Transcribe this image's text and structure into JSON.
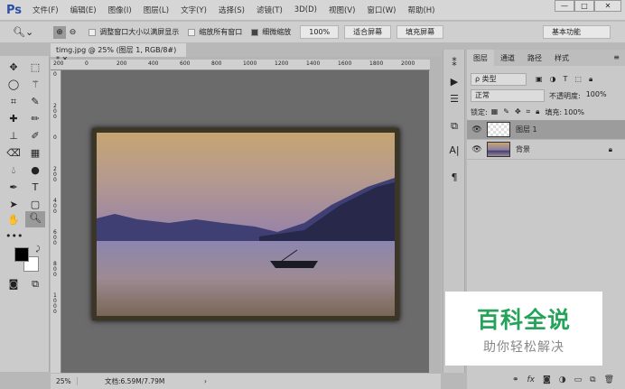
{
  "app": {
    "logo": "Ps"
  },
  "menu": [
    "文件(F)",
    "编辑(E)",
    "图像(I)",
    "图层(L)",
    "文字(Y)",
    "选择(S)",
    "滤镜(T)",
    "3D(D)",
    "视图(V)",
    "窗口(W)",
    "帮助(H)"
  ],
  "window_controls": {
    "minimize": "—",
    "maximize": "□",
    "close": "✕"
  },
  "options": {
    "resize_windows": "调整窗口大小以满屏显示",
    "resize_checked": false,
    "zoom_all": "缩放所有窗口",
    "zoom_all_checked": false,
    "scrubby": "细微缩放",
    "scrubby_checked": true,
    "btn_100": "100%",
    "btn_fit": "适合屏幕",
    "btn_fill": "填充屏幕",
    "workspace": "基本功能"
  },
  "document": {
    "tab": "timg.jpg @ 25% (图层 1, RGB/8#) *",
    "close": "✕"
  },
  "ruler": {
    "top": [
      "200",
      "0",
      "200",
      "400",
      "600",
      "800",
      "1000",
      "1200",
      "1400",
      "1600",
      "1800",
      "2000"
    ],
    "left": [
      "0",
      "200",
      "0",
      "200",
      "400",
      "600",
      "800",
      "1000"
    ]
  },
  "status": {
    "zoom": "25%",
    "doc": "文档:6.59M/7.79M",
    "arrow": "›"
  },
  "layers_panel": {
    "tabs": [
      "图层",
      "通道",
      "路径",
      "样式"
    ],
    "filter": "ρ 类型",
    "blend": "正常",
    "opacity_label": "不透明度:",
    "opacity": "100%",
    "lock_label": "锁定:",
    "fill_label": "填充:",
    "fill": "100%",
    "layers": [
      {
        "name": "图层 1",
        "selected": true
      },
      {
        "name": "背景",
        "locked": true
      }
    ]
  },
  "watermark": {
    "title": "百科全说",
    "subtitle": "助你轻松解决"
  }
}
